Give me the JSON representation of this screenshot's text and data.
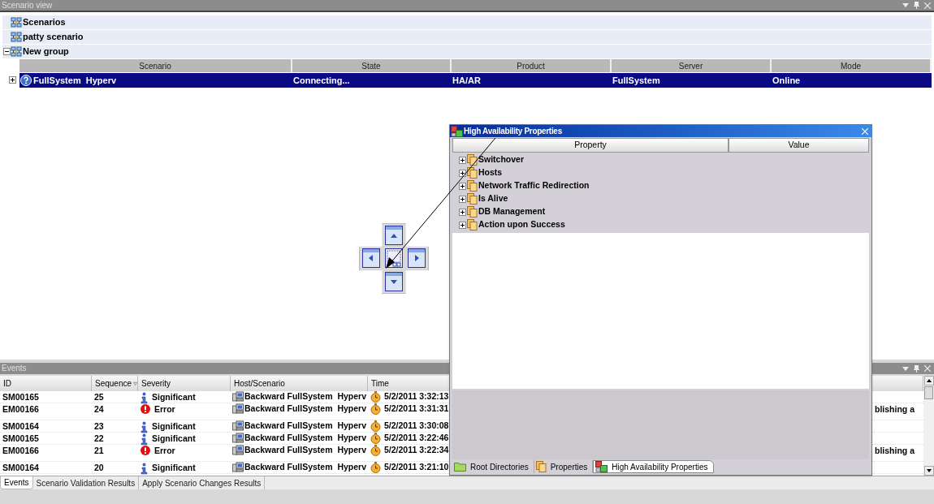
{
  "scenario_view": {
    "title": "Scenario view",
    "groups": [
      {
        "name": "Scenarios"
      },
      {
        "name": "patty scenario"
      },
      {
        "name": "New group",
        "expanded": true
      }
    ],
    "table": {
      "columns": [
        "Scenario",
        "State",
        "Product",
        "Server",
        "Mode"
      ],
      "rows": [
        {
          "scenario": "FullSystem  Hyperv",
          "state": "Connecting...",
          "product": "HA/AR",
          "server": "FullSystem",
          "mode": "Online",
          "selected": true,
          "expanded": false
        }
      ]
    }
  },
  "events": {
    "title": "Events",
    "columns": [
      {
        "label": "ID",
        "sorted": false
      },
      {
        "label": "Sequence",
        "sorted": true
      },
      {
        "label": "Severity",
        "sorted": false
      },
      {
        "label": "Host/Scenario",
        "sorted": false
      },
      {
        "label": "Time",
        "sorted": false
      }
    ],
    "rows": [
      {
        "id": "SM00165",
        "sequence": "25",
        "kind": "significant",
        "severity": "Significant",
        "host": "Backward FullSystem  Hyperv",
        "time": "5/2/2011 3:32:13"
      },
      {
        "id": "EM00166",
        "sequence": "24",
        "kind": "error",
        "severity": "Error",
        "host": "Backward FullSystem  Hyperv",
        "time": "5/2/2011 3:31:31",
        "message": "blishing a"
      },
      {
        "id": "SM00164",
        "sequence": "23",
        "kind": "significant",
        "severity": "Significant",
        "host": "Backward FullSystem  Hyperv",
        "time": "5/2/2011 3:30:08"
      },
      {
        "id": "SM00165",
        "sequence": "22",
        "kind": "significant",
        "severity": "Significant",
        "host": "Backward FullSystem  Hyperv",
        "time": "5/2/2011 3:22:46"
      },
      {
        "id": "EM00166",
        "sequence": "21",
        "kind": "error",
        "severity": "Error",
        "host": "Backward FullSystem  Hyperv",
        "time": "5/2/2011 3:22:34",
        "message": "blishing a"
      },
      {
        "id": "SM00164",
        "sequence": "20",
        "kind": "significant",
        "severity": "Significant",
        "host": "Backward FullSystem  Hyperv",
        "time": "5/2/2011 3:21:10"
      }
    ],
    "tabs": [
      {
        "label": "Events",
        "selected": true
      },
      {
        "label": "Scenario Validation Results",
        "selected": false
      },
      {
        "label": "Apply Scenario Changes Results",
        "selected": false
      }
    ]
  },
  "properties_window": {
    "title": "High Availability Properties",
    "columns": [
      "Property",
      "Value"
    ],
    "items": [
      {
        "name": "Switchover",
        "expanded": false
      },
      {
        "name": "Hosts",
        "expanded": false
      },
      {
        "name": "Network Traffic Redirection",
        "expanded": false
      },
      {
        "name": "Is Alive",
        "expanded": false
      },
      {
        "name": "DB Management",
        "expanded": false
      },
      {
        "name": "Action upon Success",
        "expanded": false
      }
    ],
    "tabs": [
      {
        "label": "Root Directories",
        "kind": "folder",
        "selected": false
      },
      {
        "label": "Properties",
        "kind": "properties",
        "selected": false
      },
      {
        "label": "High Availability Properties",
        "kind": "ha",
        "selected": true
      }
    ]
  }
}
